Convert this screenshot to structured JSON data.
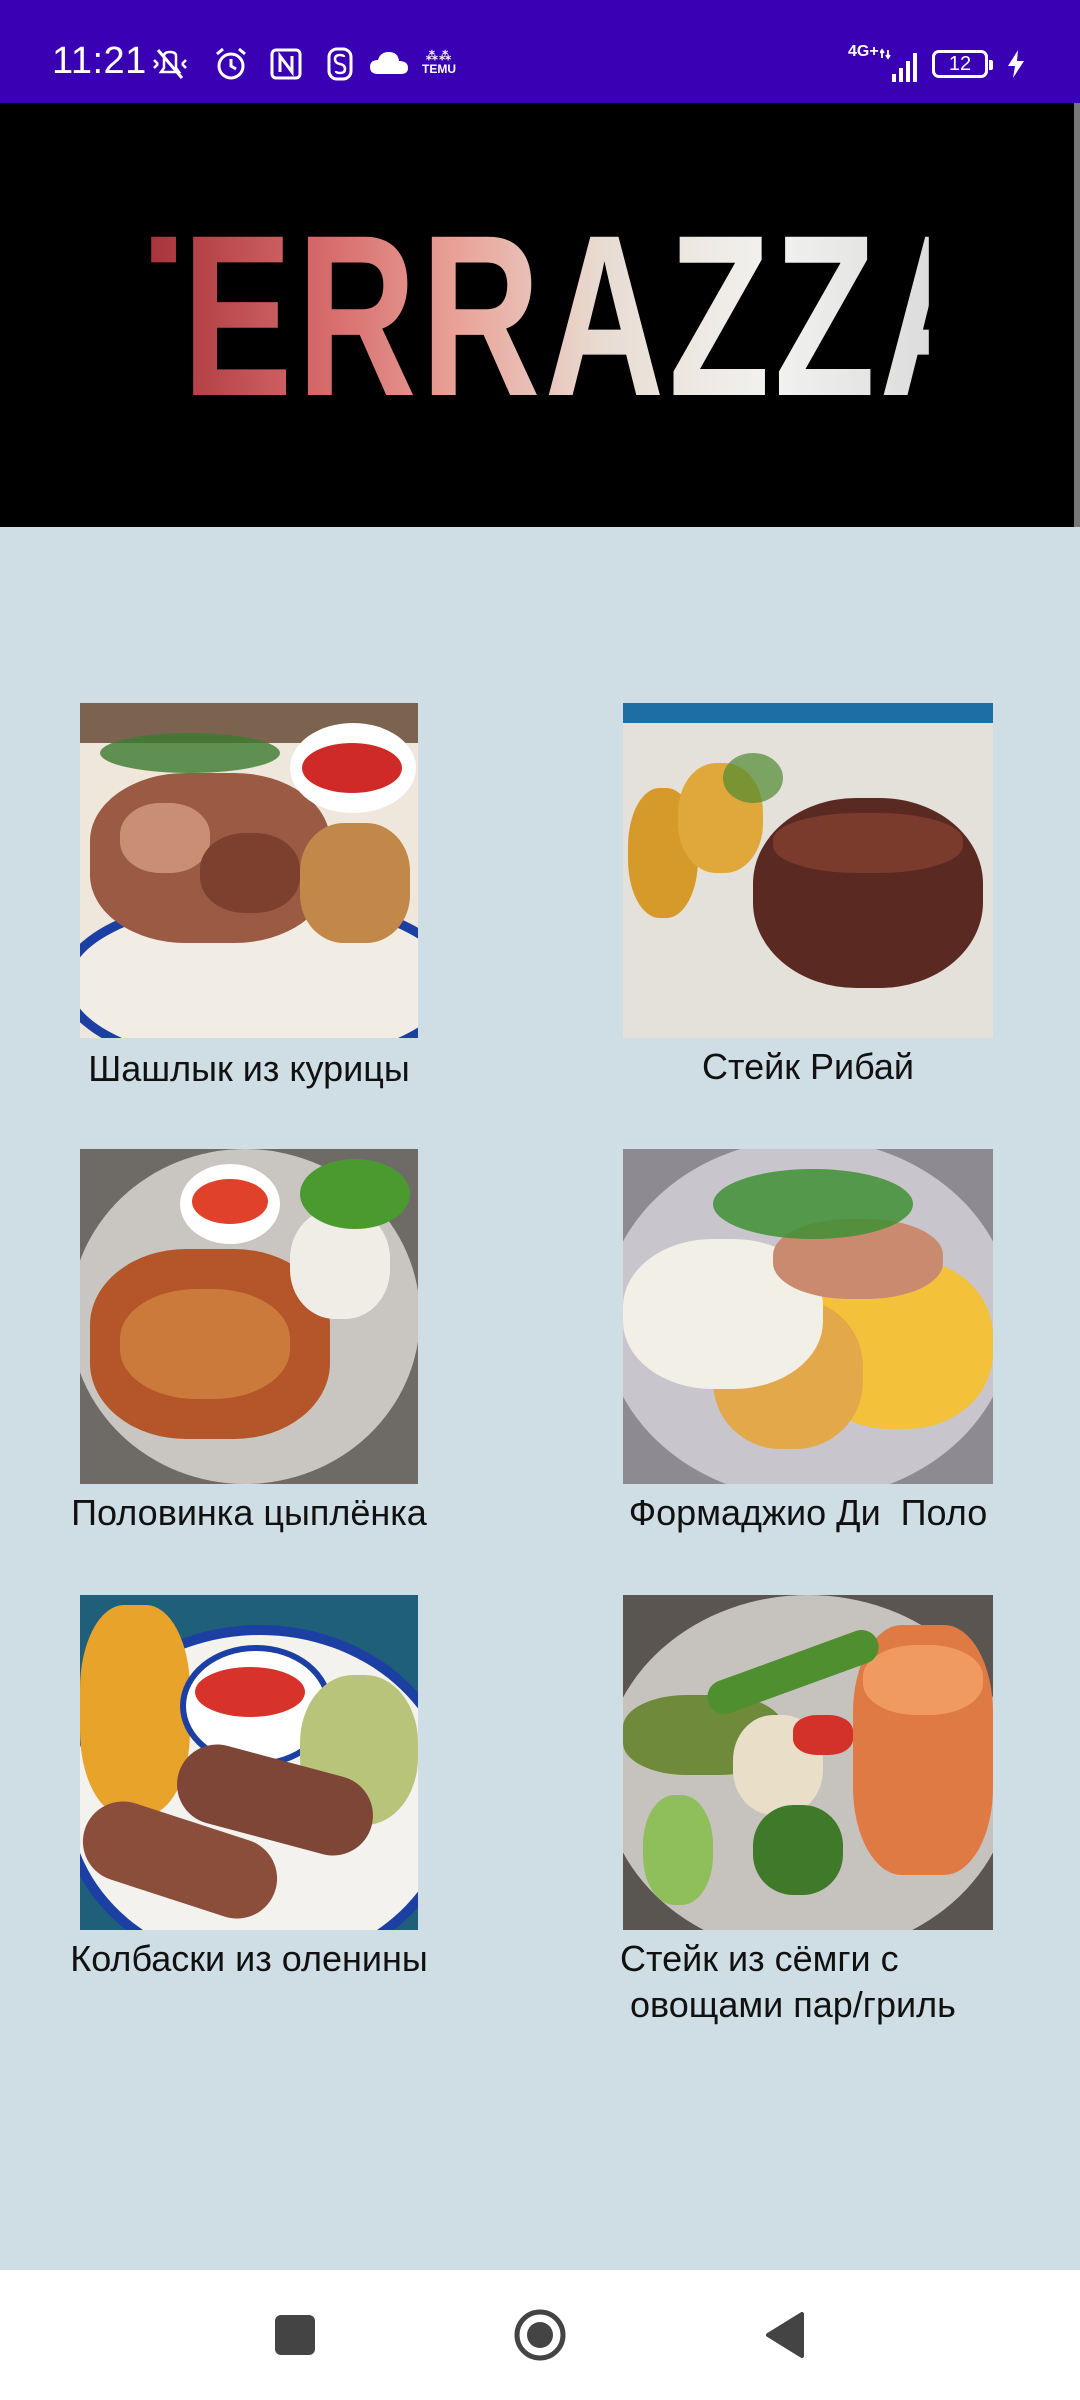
{
  "status_bar": {
    "time": "11:21",
    "network": "4G+",
    "battery_level": "12",
    "icons": [
      "mute-vibrate-icon",
      "alarm-icon",
      "nfc-icon",
      "app-s-icon",
      "cloud-icon",
      "temu-icon",
      "signal-icon",
      "battery-icon",
      "charging-bolt-icon"
    ],
    "temu_label": "TEMU",
    "accent": "#3a00b3"
  },
  "banner": {
    "logo_text": "TERRAZZA",
    "background": "#000000"
  },
  "menu": {
    "items": [
      {
        "name": "Шашлык из курицы"
      },
      {
        "name": "Стейк Рибай"
      },
      {
        "name": "Половинка цыплёнка"
      },
      {
        "name": "Формаджио Ди  Поло"
      },
      {
        "name": "Колбаски из оленины"
      },
      {
        "name": "Стейк из сёмги с\n овощами пар/гриль"
      }
    ]
  },
  "nav_bar": {
    "icons": [
      "recents-square-icon",
      "home-circle-icon",
      "back-triangle-icon"
    ]
  }
}
